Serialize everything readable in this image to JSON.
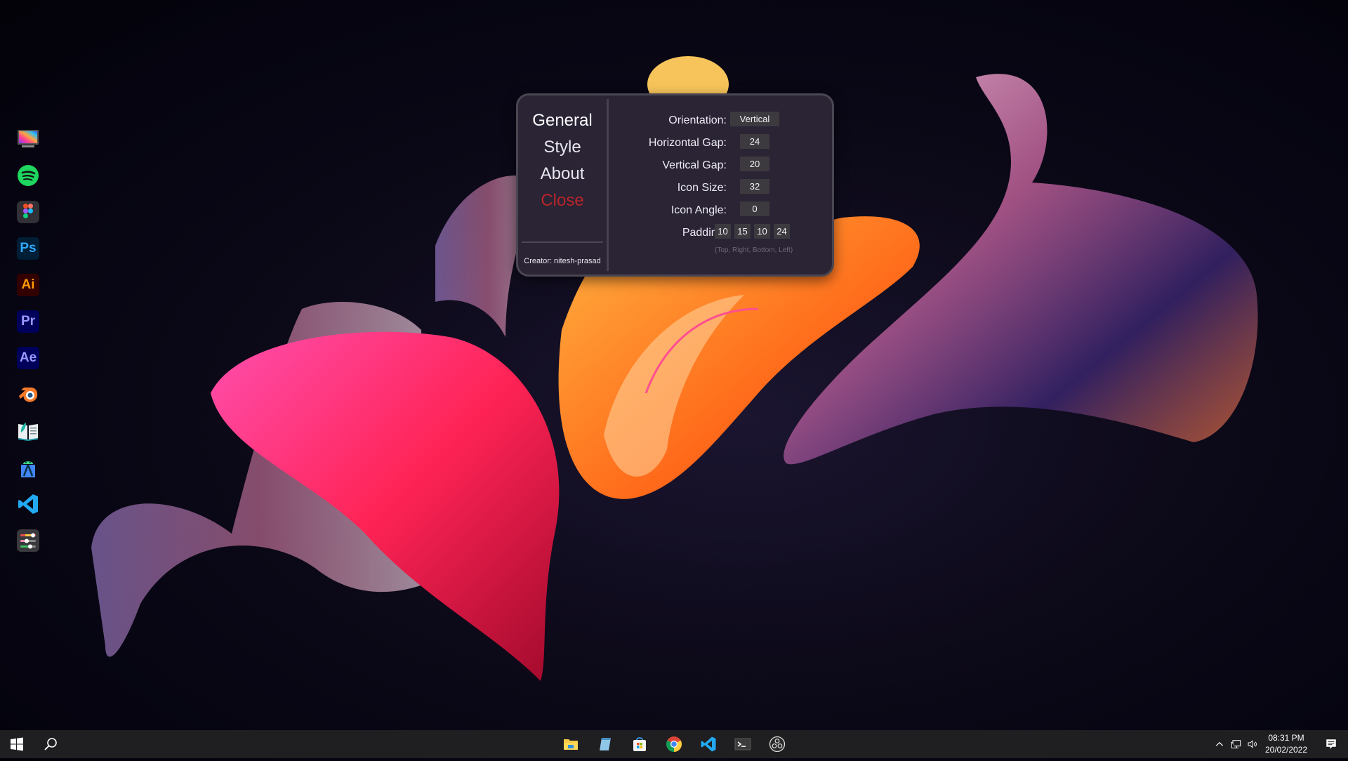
{
  "desktop": {
    "dock": {
      "items": [
        {
          "name": "desktop-display-app",
          "icon": "monitor-rainbow-icon"
        },
        {
          "name": "spotify",
          "icon": "spotify-icon"
        },
        {
          "name": "figma",
          "icon": "figma-icon"
        },
        {
          "name": "photoshop",
          "icon": "photoshop-icon",
          "label": "Ps"
        },
        {
          "name": "illustrator",
          "icon": "illustrator-icon",
          "label": "Ai"
        },
        {
          "name": "premiere-pro",
          "icon": "premiere-pro-icon",
          "label": "Pr"
        },
        {
          "name": "after-effects",
          "icon": "after-effects-icon",
          "label": "Ae"
        },
        {
          "name": "blender",
          "icon": "blender-icon"
        },
        {
          "name": "ebook-reader",
          "icon": "open-book-icon"
        },
        {
          "name": "android-studio",
          "icon": "android-studio-icon"
        },
        {
          "name": "vscode",
          "icon": "vscode-icon"
        },
        {
          "name": "dock-settings",
          "icon": "sliders-icon"
        }
      ]
    }
  },
  "dialog": {
    "nav": {
      "general": "General",
      "style": "Style",
      "about": "About",
      "close": "Close"
    },
    "creator": "Creator: nitesh-prasad",
    "settings": {
      "orientation": {
        "label": "Orientation:",
        "value": "Vertical"
      },
      "horizontal_gap": {
        "label": "Horizontal Gap:",
        "value": "24"
      },
      "vertical_gap": {
        "label": "Vertical Gap:",
        "value": "20"
      },
      "icon_size": {
        "label": "Icon Size:",
        "value": "32"
      },
      "icon_angle": {
        "label": "Icon Angle:",
        "value": "0"
      },
      "padding": {
        "label": "Padding:",
        "top": "10",
        "right": "15",
        "bottom": "10",
        "left": "24",
        "hint": "(Top, Right, Bottom, Left)"
      }
    },
    "colors": {
      "background": "#2a2435",
      "close": "#b8242a",
      "field": "#3d3a3f"
    }
  },
  "taskbar": {
    "pinned": [
      "file-explorer",
      "notepad",
      "microsoft-store",
      "chrome",
      "vscode",
      "terminal",
      "obs-studio"
    ],
    "tray": {
      "time": "08:31 PM",
      "date": "20/02/2022"
    }
  }
}
